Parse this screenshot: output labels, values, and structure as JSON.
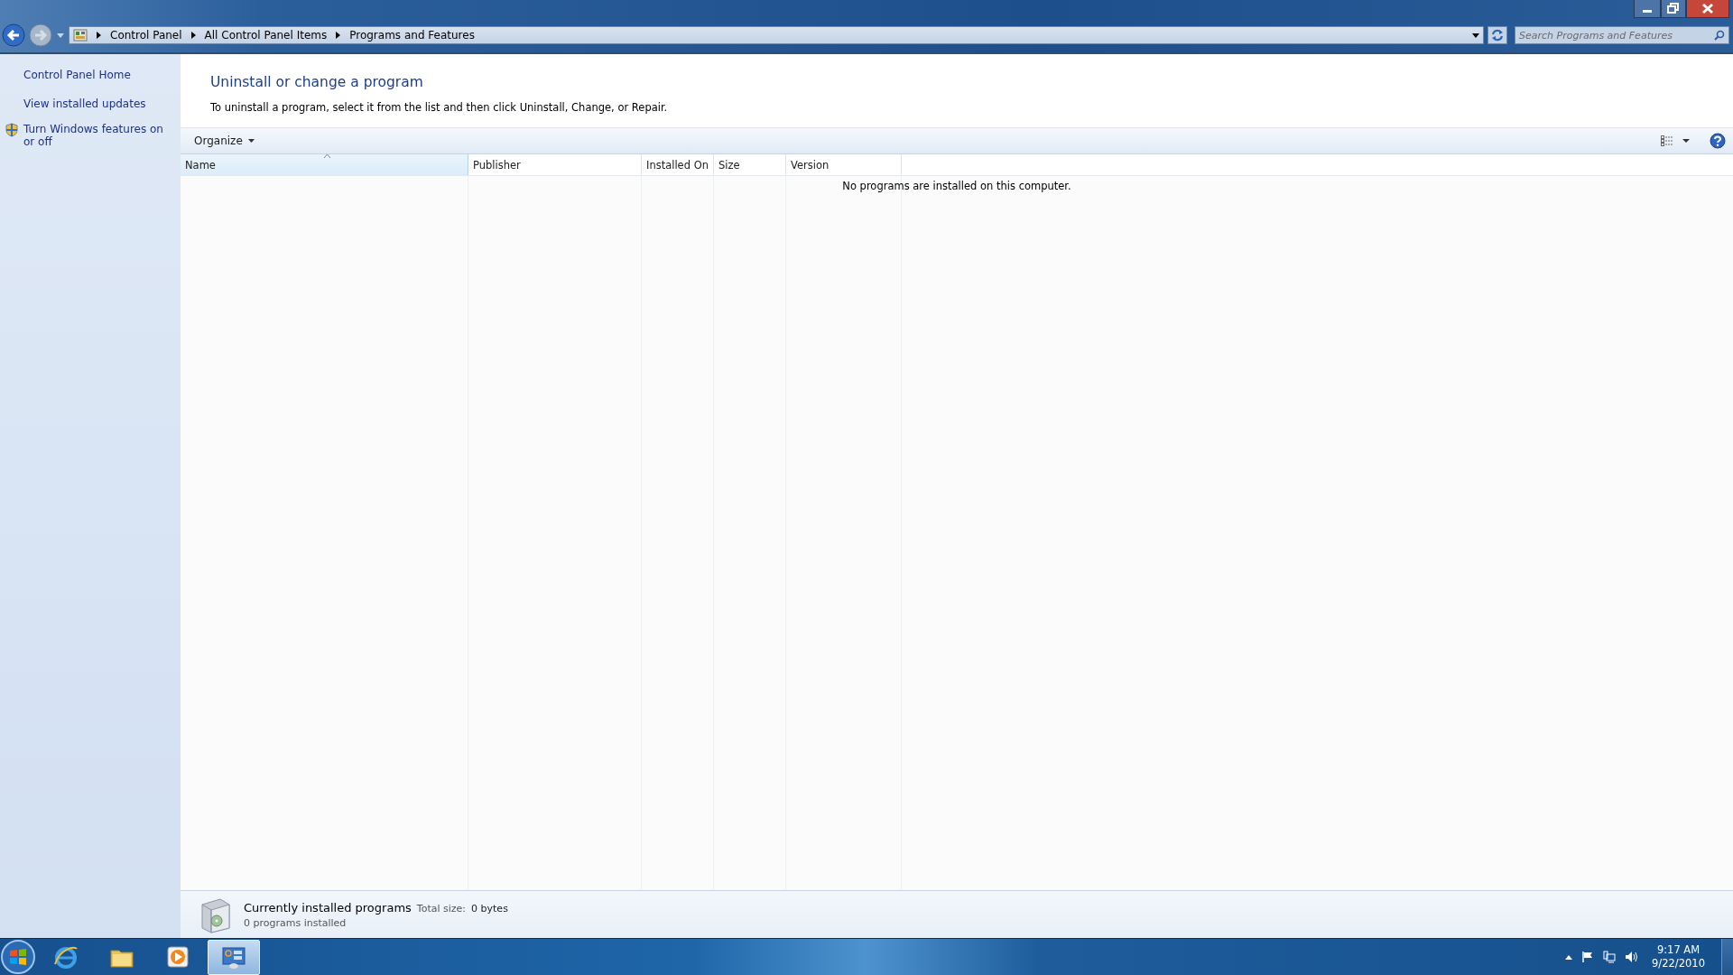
{
  "address_bar": {
    "breadcrumbs": [
      "Control Panel",
      "All Control Panel Items",
      "Programs and Features"
    ]
  },
  "search": {
    "placeholder": "Search Programs and Features"
  },
  "sidebar": {
    "links": [
      {
        "label": "Control Panel Home",
        "kind": "plain"
      },
      {
        "label": "View installed updates",
        "kind": "plain"
      },
      {
        "label": "Turn Windows features on or off",
        "kind": "shield"
      }
    ]
  },
  "main": {
    "title": "Uninstall or change a program",
    "instructions": "To uninstall a program, select it from the list and then click Uninstall, Change, or Repair."
  },
  "toolbar": {
    "organize": "Organize"
  },
  "table": {
    "columns": [
      {
        "label": "Name",
        "sorted": true
      },
      {
        "label": "Publisher",
        "sorted": false
      },
      {
        "label": "Installed On",
        "sorted": false
      },
      {
        "label": "Size",
        "sorted": false
      },
      {
        "label": "Version",
        "sorted": false
      }
    ],
    "empty_message": "No programs are installed on this computer."
  },
  "details": {
    "title": "Currently installed programs",
    "total_size_label": "Total size:",
    "total_size": "0 bytes",
    "count": "0 programs installed"
  },
  "taskbar": {
    "apps": [
      {
        "kind": "browser",
        "selected": false
      },
      {
        "kind": "folder",
        "selected": false
      },
      {
        "kind": "media",
        "selected": false
      },
      {
        "kind": "control-panel",
        "selected": true
      }
    ],
    "clock": {
      "time": "9:17 AM",
      "date": "9/22/2010"
    }
  }
}
